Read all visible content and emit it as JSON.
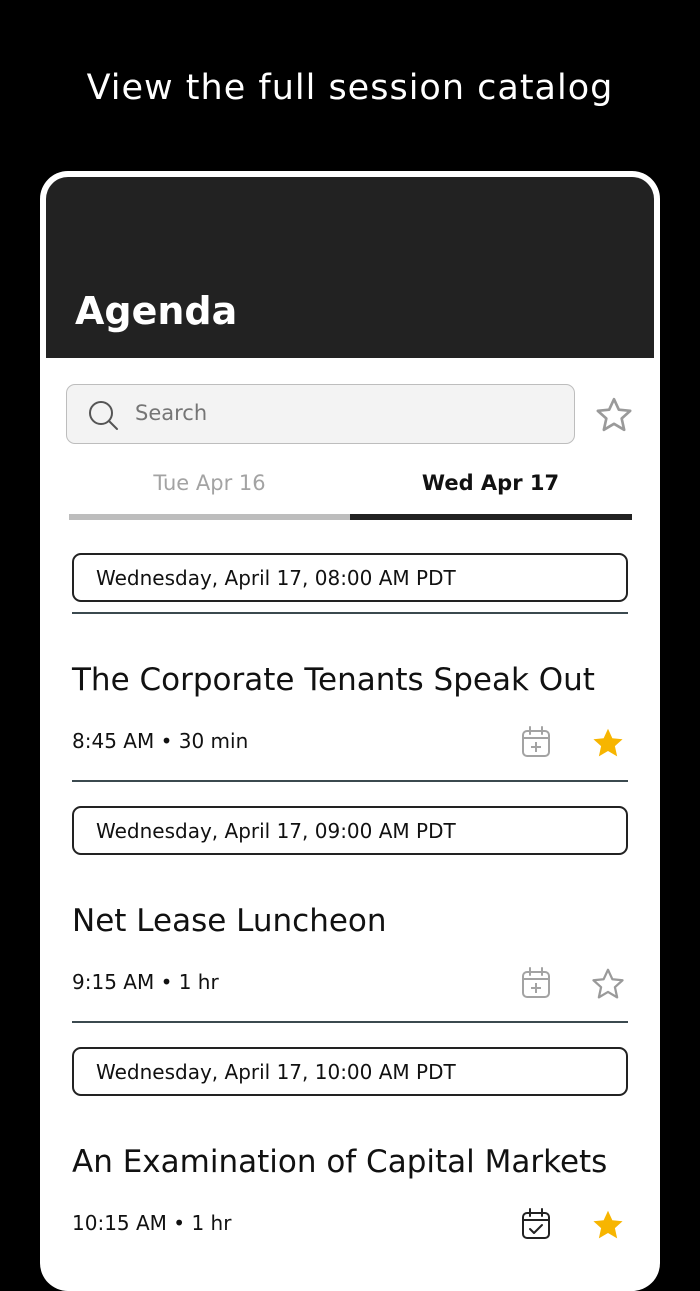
{
  "promo": {
    "title": "View the full session catalog"
  },
  "header": {
    "title": "Agenda"
  },
  "search": {
    "placeholder": "Search"
  },
  "tabs": [
    {
      "label": "Tue Apr 16",
      "active": false
    },
    {
      "label": "Wed Apr 17",
      "active": true
    }
  ],
  "groups": [
    {
      "time_header": "Wednesday, April 17, 08:00 AM PDT",
      "session": {
        "title": "The Corporate Tenants Speak Out",
        "meta": "8:45 AM • 30 min",
        "calendar": "calendar-add-icon",
        "favorite": true
      }
    },
    {
      "time_header": "Wednesday, April 17, 09:00 AM PDT",
      "session": {
        "title": "Net Lease Luncheon",
        "meta": "9:15 AM • 1 hr",
        "calendar": "calendar-add-icon",
        "favorite": false
      }
    },
    {
      "time_header": "Wednesday, April 17, 10:00 AM PDT",
      "session": {
        "title": "An Examination of Capital Markets",
        "meta": "10:15 AM • 1 hr",
        "calendar": "calendar-check-icon",
        "favorite": true
      }
    }
  ],
  "colors": {
    "accent_star": "#f7b500",
    "header_bg": "#222222",
    "icon_gray": "#a3a3a3"
  }
}
